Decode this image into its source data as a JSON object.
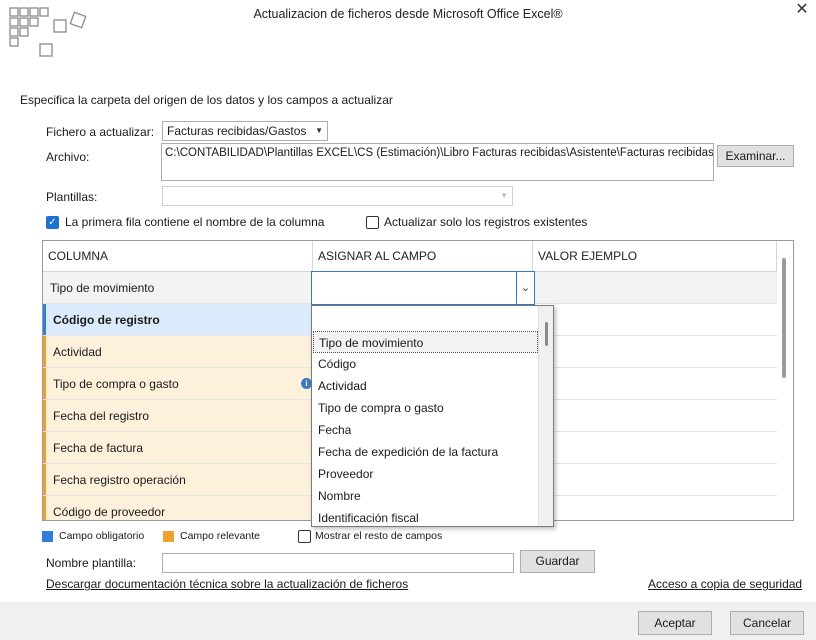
{
  "window": {
    "title": "Actualizacion de ficheros desde Microsoft Office Excel®",
    "close_glyph": "✕"
  },
  "instruction": "Especifica la carpeta del origen de los datos y los campos a actualizar",
  "form": {
    "fichero_label": "Fichero a actualizar:",
    "fichero_value": "Facturas recibidas/Gastos",
    "archivo_label": "Archivo:",
    "archivo_value": "C:\\CONTABILIDAD\\Plantillas EXCEL\\CS (Estimación)\\Libro Facturas recibidas\\Asistente\\Facturas recibidas asis",
    "examinar_label": "Examinar...",
    "plantillas_label": "Plantillas:",
    "plantillas_value": "",
    "chk_primera_fila_label": "La primera fila contiene el nombre de la columna",
    "chk_primera_fila_checked": true,
    "chk_actualizar_label": "Actualizar solo los registros existentes",
    "chk_actualizar_checked": false
  },
  "grid": {
    "headers": [
      "COLUMNA",
      "ASIGNAR AL CAMPO",
      "VALOR EJEMPLO"
    ],
    "rows": [
      {
        "columna": "Tipo de movimiento",
        "kind": "normal"
      },
      {
        "columna": "Código de registro",
        "kind": "required"
      },
      {
        "columna": "Actividad",
        "kind": "relevant"
      },
      {
        "columna": "Tipo de compra o gasto",
        "kind": "relevant",
        "info": true
      },
      {
        "columna": "Fecha del registro",
        "kind": "relevant"
      },
      {
        "columna": "Fecha de factura",
        "kind": "relevant"
      },
      {
        "columna": "Fecha registro operación",
        "kind": "relevant"
      },
      {
        "columna": "Código de proveedor",
        "kind": "relevant"
      }
    ]
  },
  "dropdown": {
    "selected_index": 0,
    "options": [
      "Tipo de movimiento",
      "Código",
      "Actividad",
      "Tipo de compra o gasto",
      "Fecha",
      "Fecha de expedición de la factura",
      "Proveedor",
      "Nombre",
      "Identificación fiscal"
    ]
  },
  "legend": {
    "obligatorio_label": "Campo obligatorio",
    "obligatorio_color": "#2f7fd8",
    "relevante_label": "Campo relevante",
    "relevante_color": "#f0a030",
    "mostrar_label": "Mostrar el resto de campos",
    "mostrar_checked": false
  },
  "plantilla": {
    "label": "Nombre plantilla:",
    "value": "",
    "guardar_label": "Guardar"
  },
  "links": {
    "descargar": "Descargar documentación técnica sobre la actualización de ficheros",
    "copia": "Acceso a copia de seguridad"
  },
  "footer": {
    "aceptar": "Aceptar",
    "cancelar": "Cancelar"
  }
}
